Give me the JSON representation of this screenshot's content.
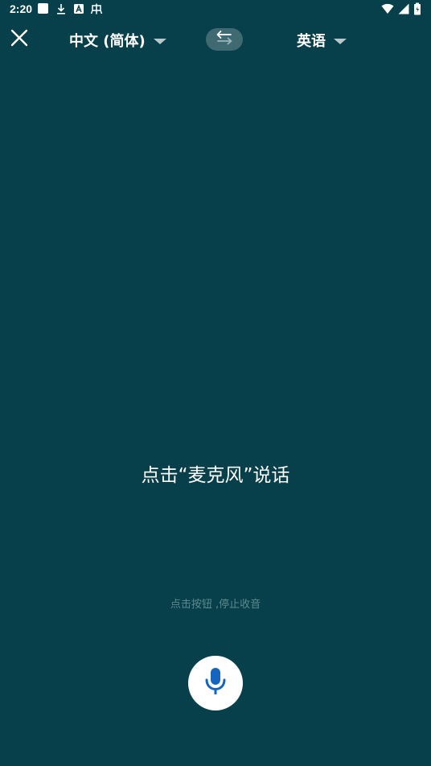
{
  "status_bar": {
    "time": "2:20",
    "left_icons": [
      "square-icon",
      "download-icon",
      "text-a-icon",
      "app-icon"
    ],
    "right_icons": [
      "wifi-icon",
      "signal-icon",
      "battery-icon"
    ]
  },
  "top_bar": {
    "close_icon": "close-icon",
    "source_language": "中文 (简体)",
    "target_language": "英语",
    "swap_icon": "swap-arrows-icon"
  },
  "main": {
    "prompt": "点击“麦克风”说话",
    "hint": "点击按钮 ,停止收音",
    "mic_icon": "microphone-icon"
  },
  "colors": {
    "background": "#073f4a",
    "text": "#ffffff",
    "hint_text": "#5e8a90",
    "swap_button_bg": "#3f6a72",
    "mic_button_bg": "#ffffff",
    "mic_icon": "#1565c0"
  }
}
